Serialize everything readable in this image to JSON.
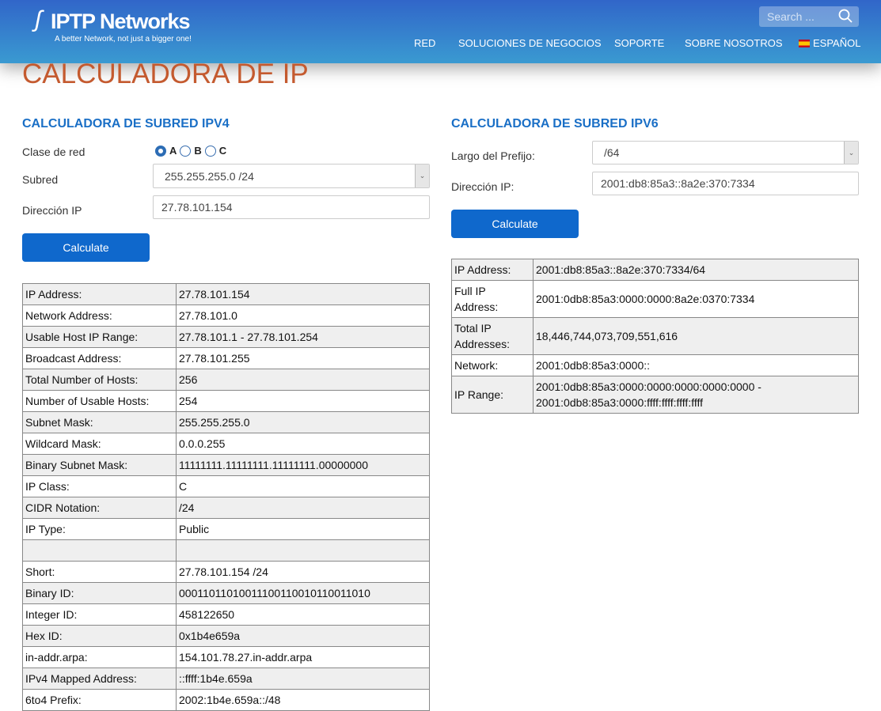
{
  "header": {
    "logo_name": "IPTP Networks",
    "logo_tagline": "A better Network, not just a bigger one!",
    "search_placeholder": "Search ...",
    "nav": [
      "RED",
      "SOLUCIONES DE NEGOCIOS",
      "SOPORTE",
      "SOBRE NOSOTROS",
      "ESPAÑOL"
    ]
  },
  "page_title": "CALCULADORA DE IP",
  "ipv4": {
    "heading": "CALCULADORA DE SUBRED IPV4",
    "class_label": "Clase de red",
    "classes": [
      "A",
      "B",
      "C"
    ],
    "selected_class": "A",
    "subnet_label": "Subred",
    "subnet_value": "255.255.255.0 /24",
    "ip_label": "Dirección IP",
    "ip_value": "27.78.101.154",
    "button": "Calculate",
    "results": [
      [
        "IP Address:",
        "27.78.101.154"
      ],
      [
        "Network Address:",
        "27.78.101.0"
      ],
      [
        "Usable Host IP Range:",
        "27.78.101.1 - 27.78.101.254"
      ],
      [
        "Broadcast Address:",
        "27.78.101.255"
      ],
      [
        "Total Number of Hosts:",
        "256"
      ],
      [
        "Number of Usable Hosts:",
        "254"
      ],
      [
        "Subnet Mask:",
        "255.255.255.0"
      ],
      [
        "Wildcard Mask:",
        "0.0.0.255"
      ],
      [
        "Binary Subnet Mask:",
        "11111111.11111111.11111111.00000000"
      ],
      [
        "IP Class:",
        "C"
      ],
      [
        "CIDR Notation:",
        "/24"
      ],
      [
        "IP Type:",
        "Public"
      ],
      [
        "",
        ""
      ],
      [
        "Short:",
        "27.78.101.154 /24"
      ],
      [
        "Binary ID:",
        "00011011010011100110010110011010"
      ],
      [
        "Integer ID:",
        "458122650"
      ],
      [
        "Hex ID:",
        "0x1b4e659a"
      ],
      [
        "in-addr.arpa:",
        "154.101.78.27.in-addr.arpa"
      ],
      [
        "IPv4 Mapped Address:",
        "::ffff:1b4e.659a"
      ],
      [
        "6to4 Prefix:",
        "2002:1b4e.659a::/48"
      ]
    ]
  },
  "ipv6": {
    "heading": "CALCULADORA DE SUBRED IPV6",
    "prefix_label": "Largo del Prefijo:",
    "prefix_value": "/64",
    "ip_label": "Dirección IP:",
    "ip_value": "2001:db8:85a3::8a2e:370:7334",
    "button": "Calculate",
    "results": [
      [
        "IP Address:",
        "2001:db8:85a3::8a2e:370:7334/64"
      ],
      [
        "Full IP Address:",
        "2001:0db8:85a3:0000:0000:8a2e:0370:7334"
      ],
      [
        "Total IP Addresses:",
        "18,446,744,073,709,551,616"
      ],
      [
        "Network:",
        "2001:0db8:85a3:0000::"
      ],
      [
        "IP Range:",
        "2001:0db8:85a3:0000:0000:0000:0000:0000 - 2001:0db8:85a3:0000:ffff:ffff:ffff:ffff"
      ]
    ]
  }
}
